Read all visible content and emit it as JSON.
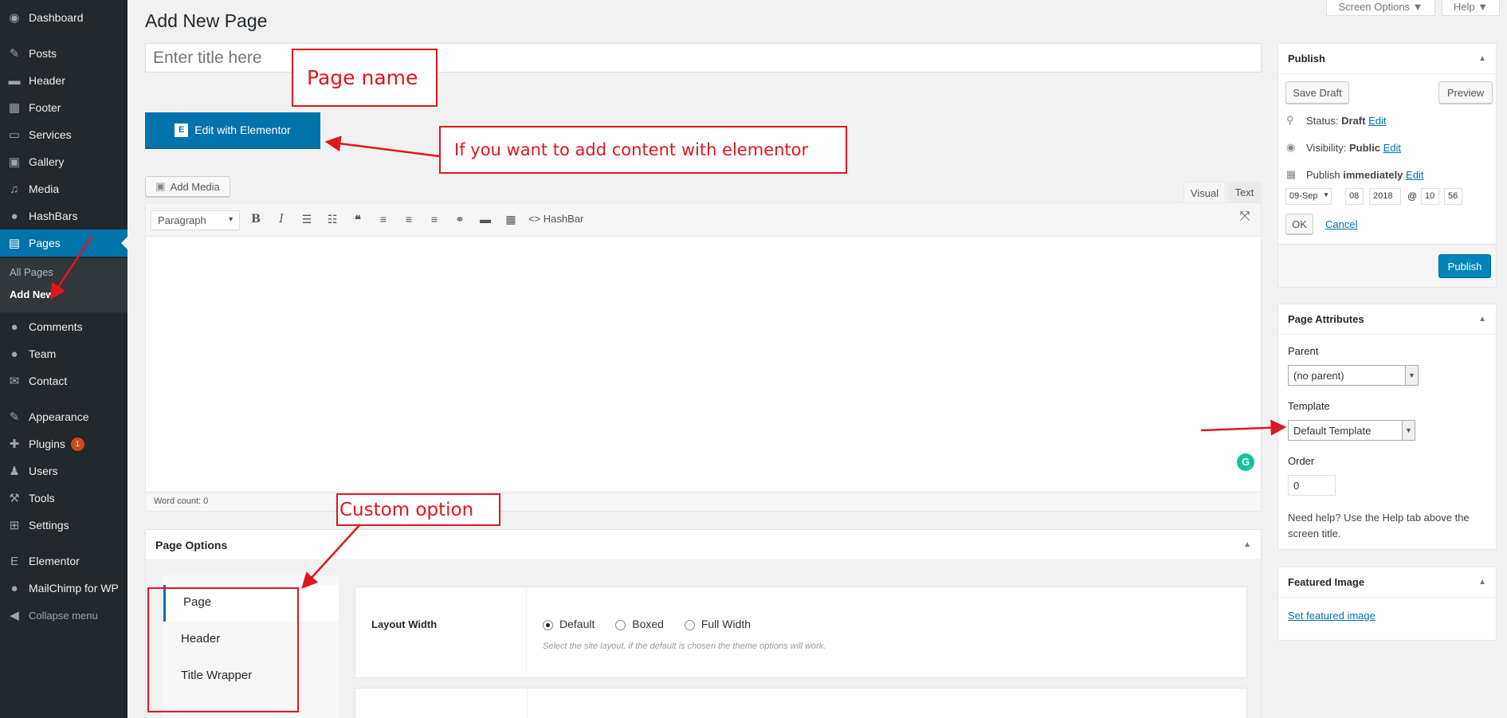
{
  "sidebar": {
    "items": [
      {
        "label": "Dashboard",
        "icon": "dashboard-icon",
        "glyph": "◉"
      },
      {
        "label": "Posts",
        "icon": "pin-icon",
        "glyph": "✎"
      },
      {
        "label": "Header",
        "icon": "header-icon",
        "glyph": "▬"
      },
      {
        "label": "Footer",
        "icon": "footer-icon",
        "glyph": "▦"
      },
      {
        "label": "Services",
        "icon": "monitor-icon",
        "glyph": "▭"
      },
      {
        "label": "Gallery",
        "icon": "gallery-icon",
        "glyph": "▣"
      },
      {
        "label": "Media",
        "icon": "media-icon",
        "glyph": "♫"
      },
      {
        "label": "HashBars",
        "icon": "comment-icon",
        "glyph": "●"
      },
      {
        "label": "Pages",
        "icon": "pages-icon",
        "glyph": "▤"
      },
      {
        "label": "Comments",
        "icon": "comments-icon",
        "glyph": "●"
      },
      {
        "label": "Team",
        "icon": "team-icon",
        "glyph": "●"
      },
      {
        "label": "Contact",
        "icon": "mail-icon",
        "glyph": "✉"
      },
      {
        "label": "Appearance",
        "icon": "brush-icon",
        "glyph": "✎"
      },
      {
        "label": "Plugins",
        "icon": "plugin-icon",
        "glyph": "✚",
        "badge": "1"
      },
      {
        "label": "Users",
        "icon": "user-icon",
        "glyph": "♟"
      },
      {
        "label": "Tools",
        "icon": "wrench-icon",
        "glyph": "⚒"
      },
      {
        "label": "Settings",
        "icon": "settings-icon",
        "glyph": "⊞"
      },
      {
        "label": "Elementor",
        "icon": "elementor-icon",
        "glyph": "E"
      },
      {
        "label": "MailChimp for WP",
        "icon": "mailchimp-icon",
        "glyph": "●"
      },
      {
        "label": "Collapse menu",
        "icon": "collapse-icon",
        "glyph": "◀"
      }
    ],
    "submenu": {
      "all_pages": "All Pages",
      "add_new": "Add New"
    }
  },
  "top": {
    "screen_options": "Screen Options ▼",
    "help": "Help ▼"
  },
  "page_title": "Add New Page",
  "title_placeholder": "Enter title here",
  "elementor_btn": "Edit with Elementor",
  "add_media": "Add Media",
  "editor": {
    "tab_visual": "Visual",
    "tab_text": "Text",
    "format": "Paragraph",
    "hashbar": "HashBar",
    "word_count": "Word count: 0"
  },
  "page_options": {
    "title": "Page Options",
    "tabs": [
      "Page",
      "Header",
      "Title Wrapper"
    ],
    "layout_label": "Layout Width",
    "radios": [
      "Default",
      "Boxed",
      "Full Width"
    ],
    "help": "Select the site layout. if the default is chosen the theme options will work."
  },
  "publish": {
    "title": "Publish",
    "save_draft": "Save Draft",
    "preview": "Preview",
    "status_label": "Status:",
    "status_value": "Draft",
    "visibility_label": "Visibility:",
    "visibility_value": "Public",
    "publish_label": "Publish",
    "publish_value": "immediately",
    "edit": "Edit",
    "month": "09-Sep",
    "day": "08",
    "year": "2018",
    "at": "@",
    "hour": "10",
    "minute": "56",
    "ok": "OK",
    "cancel": "Cancel",
    "publish_btn": "Publish"
  },
  "attributes": {
    "title": "Page Attributes",
    "parent_label": "Parent",
    "parent_value": "(no parent)",
    "template_label": "Template",
    "template_value": "Default Template",
    "order_label": "Order",
    "order_value": "0",
    "help": "Need help? Use the Help tab above the screen title."
  },
  "featured": {
    "title": "Featured Image",
    "link": "Set featured image"
  },
  "annotations": {
    "page_name": "Page  name",
    "elementor": "If  you  want to  add content  with  elementor",
    "custom": "Custom  option"
  },
  "colors": {
    "accent": "#0073aa",
    "annotation": "#e0161e",
    "sidebar": "#23282d"
  }
}
